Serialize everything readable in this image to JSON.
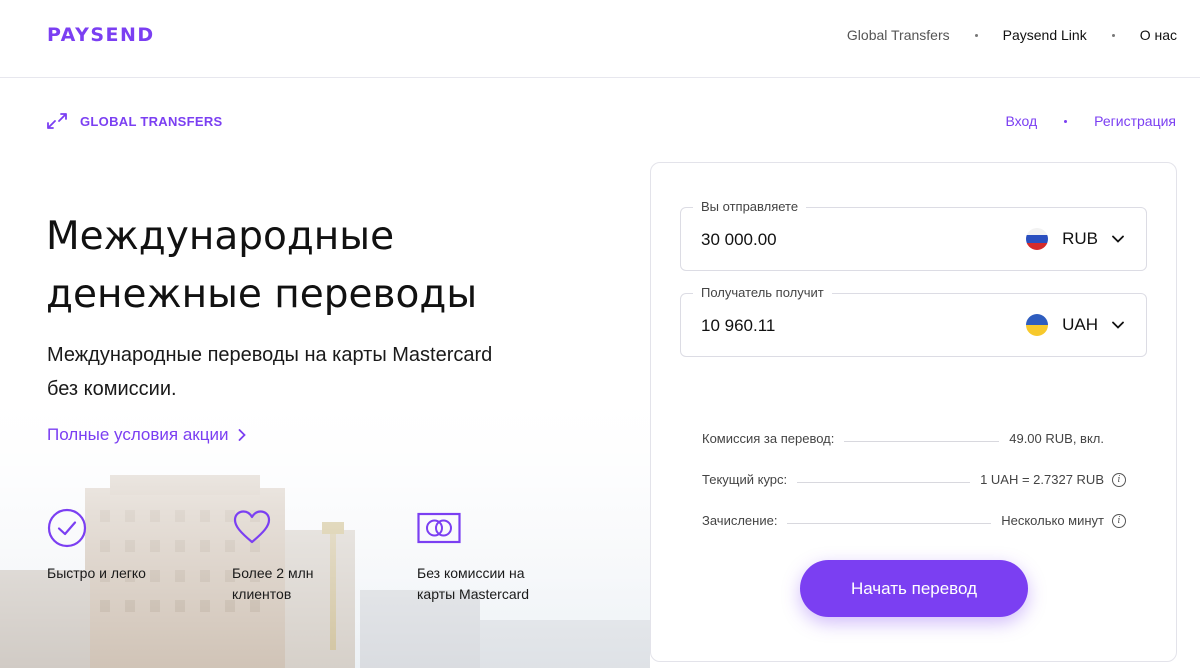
{
  "brand": {
    "logo_text": "PAYSEND",
    "accent": "#7b3ff2"
  },
  "topnav": {
    "items": [
      {
        "label": "Global Transfers"
      },
      {
        "label": "Paysend Link"
      },
      {
        "label": "О нас"
      }
    ]
  },
  "subheader": {
    "section_title": "GLOBAL TRANSFERS",
    "icon": "diagonal-arrows-icon"
  },
  "auth": {
    "login_label": "Вход",
    "register_label": "Регистрация"
  },
  "hero": {
    "title_line1": "Международные",
    "title_line2": "денежные переводы",
    "subtitle": "Международные переводы на карты Mastercard без комиссии.",
    "promo_link": "Полные условия акции"
  },
  "features": [
    {
      "icon": "check-circle-icon",
      "line1": "Быстро и легко",
      "line2": ""
    },
    {
      "icon": "heart-icon",
      "line1": "Более 2 млн",
      "line2": "клиентов"
    },
    {
      "icon": "mastercard-icon",
      "line1": "Без комиссии на",
      "line2": "карты Mastercard"
    }
  ],
  "calculator": {
    "send": {
      "label": "Вы отправляете",
      "value": "30 000.00",
      "currency": "RUB",
      "flag": "russia-flag-icon"
    },
    "receive": {
      "label": "Получатель получит",
      "value": "10 960.11",
      "currency": "UAH",
      "flag": "ukraine-flag-icon"
    },
    "fee": {
      "label": "Комиссия за перевод:",
      "value": "49.00 RUB, вкл."
    },
    "rate": {
      "label": "Текущий курс:",
      "value": "1 UAH = 2.7327 RUB"
    },
    "delivery": {
      "label": "Зачисление:",
      "value": "Несколько минут"
    },
    "submit_label": "Начать перевод"
  }
}
